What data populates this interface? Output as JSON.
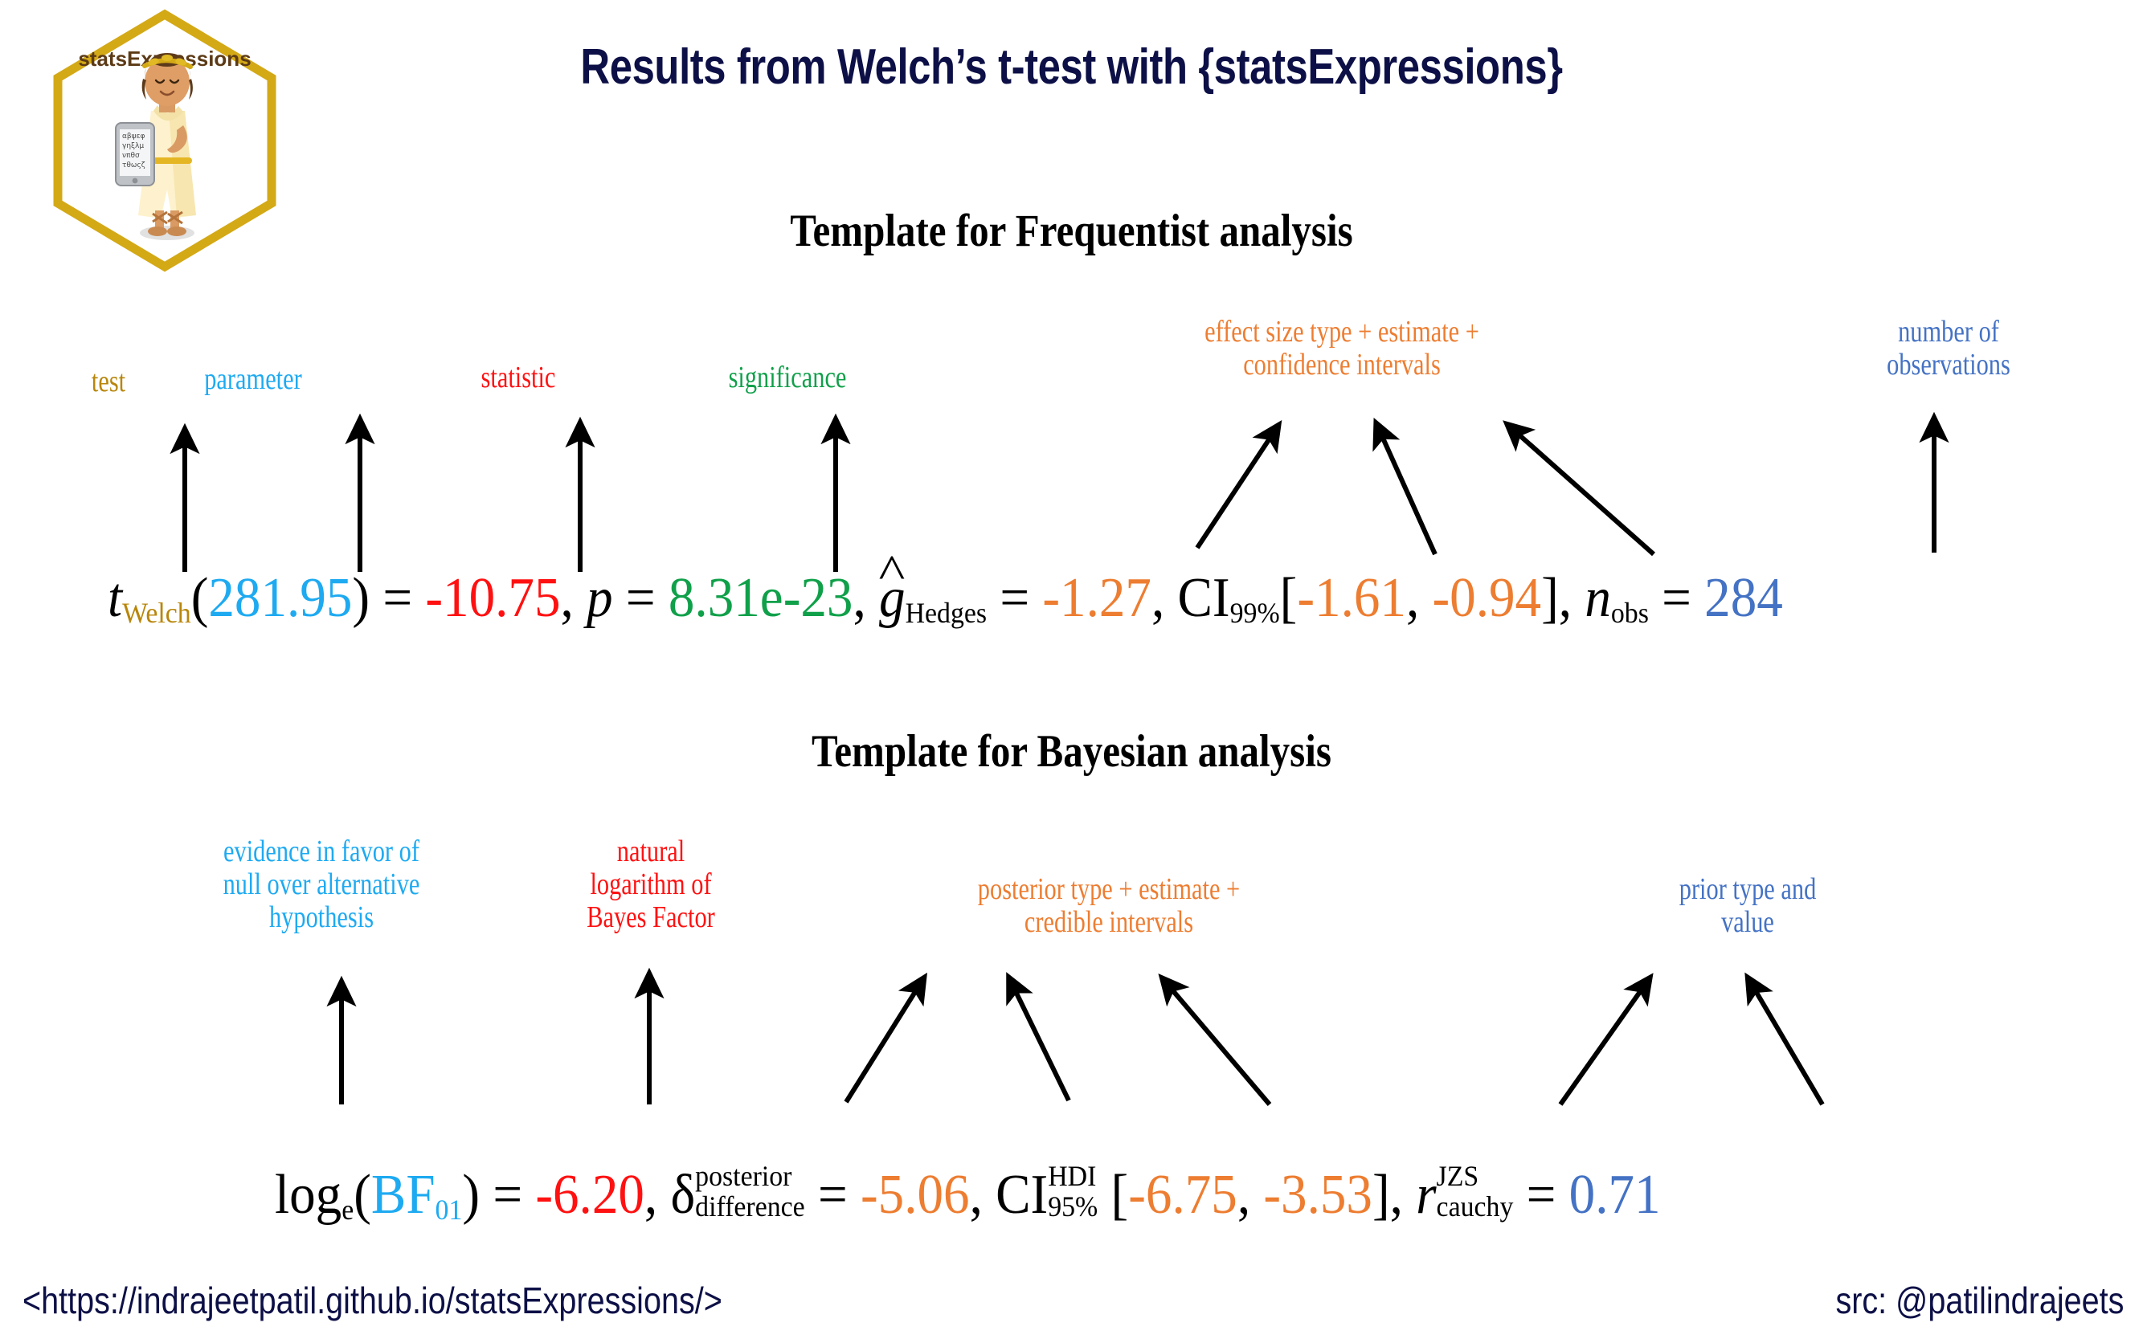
{
  "title": "Results from Welch’s t-test with {statsExpressions}",
  "logo": {
    "wordmark": "statsExpressions",
    "tablet_lines": [
      "αβψεφ",
      "γηξλμ",
      "νπθσ",
      "τθωςζ"
    ],
    "border_color": "#d4a916",
    "wordmark_color": "#5c3a16"
  },
  "colors": {
    "title": "#0d1046",
    "test": "#b8860b",
    "parameter": "#1eaaf1",
    "statistic": "#ff1111",
    "significance": "#10a04a",
    "effectsize": "#ed7d31",
    "observations": "#4472c4",
    "black": "#000000"
  },
  "frequentist": {
    "heading": "Template for Frequentist analysis",
    "labels": [
      {
        "name": "test",
        "text": "test",
        "color": "#b8860b"
      },
      {
        "name": "parameter",
        "text": "parameter",
        "color": "#1eaaf1"
      },
      {
        "name": "statistic",
        "text": "statistic",
        "color": "#ff1111"
      },
      {
        "name": "significance",
        "text": "significance",
        "color": "#10a04a"
      },
      {
        "name": "effect-size",
        "line1": "effect size type + estimate +",
        "line2": "confidence intervals",
        "color": "#ed7d31"
      },
      {
        "name": "observations",
        "line1": "number of",
        "line2": "observations",
        "color": "#4472c4"
      }
    ],
    "expression": {
      "statistic_symbol": "t",
      "test_sub": "Welch",
      "parameter_value": "281.95",
      "statistic_value": "-10.75",
      "p_symbol": "p",
      "p_value": "8.31e-23",
      "effect_symbol": "g",
      "effect_sub": "Hedges",
      "effect_value": "-1.27",
      "ci_label": "CI",
      "ci_level": "99%",
      "ci_low": "-1.61",
      "ci_high": "-0.94",
      "n_symbol": "n",
      "n_sub": "obs",
      "n_value": "284",
      "eq": "=",
      "comma": ",",
      "lparen": "(",
      "rparen": ")",
      "lbracket": "[",
      "rbracket": "]"
    }
  },
  "bayesian": {
    "heading": "Template for Bayesian analysis",
    "labels": [
      {
        "name": "evidence",
        "line1": "evidence in favor of",
        "line2": "null over alternative",
        "line3": "hypothesis",
        "color": "#1eaaf1"
      },
      {
        "name": "log-bf",
        "line1": "natural",
        "line2": "logarithm of",
        "line3": "Bayes Factor",
        "color": "#ff1111"
      },
      {
        "name": "posterior",
        "line1": "posterior type + estimate +",
        "line2": "credible intervals",
        "color": "#ed7d31"
      },
      {
        "name": "prior",
        "line1": "prior type and",
        "line2": "value",
        "color": "#4472c4"
      }
    ],
    "expression": {
      "log_label": "log",
      "log_sub": "e",
      "bf_label": "BF",
      "bf_sub": "01",
      "bf_value": "-6.20",
      "delta_symbol": "δ",
      "delta_sup": "posterior",
      "delta_sub": "difference",
      "delta_value": "-5.06",
      "ci_label": "CI",
      "ci_sup": "HDI",
      "ci_sub": "95%",
      "ci_low": "-6.75",
      "ci_high": "-3.53",
      "prior_symbol": "r",
      "prior_sup": "JZS",
      "prior_sub": "cauchy",
      "prior_value": "0.71",
      "eq": "=",
      "comma": ",",
      "lparen": "(",
      "rparen": ")",
      "lbracket": "[",
      "rbracket": "]"
    }
  },
  "footer": {
    "url": "<https://indrajeetpatil.github.io/statsExpressions/>",
    "src": "src: @patilindrajeets"
  }
}
